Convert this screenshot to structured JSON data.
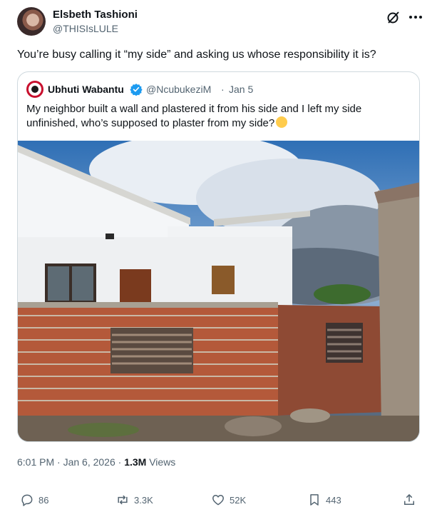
{
  "tweet": {
    "author_name": "Elsbeth Tashioni",
    "author_handle": "@THISIsLULE",
    "text": "You’re busy calling it “my side” and asking us whose responsibility it is?",
    "time": "6:01 PM · Jan 6, 2026 ·",
    "views_count": "1.3M",
    "views_label": "Views"
  },
  "quote": {
    "author_name": "Ubhuti Wabantu",
    "author_handle": "@NcubukeziM",
    "separator": "·",
    "date": "Jan 5",
    "text": "My neighbor built a wall and plastered it from his side and I left my side unfinished, who’s supposed to plaster from my side?"
  },
  "actions": {
    "replies": "86",
    "reposts": "3.3K",
    "likes": "52K",
    "bookmarks": "443"
  },
  "icons": {
    "header": [
      "grok-icon",
      "more-icon"
    ],
    "actions": [
      "reply-icon",
      "repost-icon",
      "like-icon",
      "bookmark-icon",
      "share-icon"
    ]
  },
  "colors": {
    "text": "#0f1419",
    "secondary": "#536471",
    "border": "#cfd9de",
    "verified": "#1d9bf0"
  }
}
